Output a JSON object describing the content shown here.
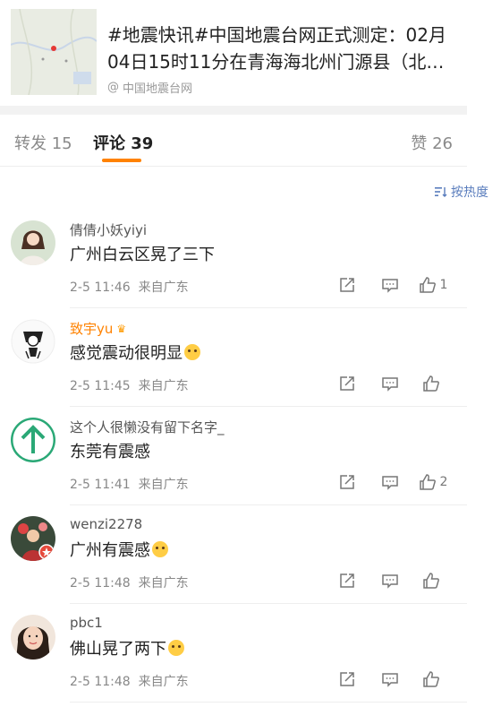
{
  "card": {
    "title": "#地震快讯#中国地震台网正式测定：02月04日15时11分在青海海北州门源县（北…",
    "source": "中国地震台网"
  },
  "tabs": {
    "repost": "转发 15",
    "comment": "评论 39",
    "like": "赞 26"
  },
  "sort": {
    "label": "按热度"
  },
  "comments": [
    {
      "nick": "倩倩小妖yiyi",
      "text": "广州白云区晃了三下",
      "time": "2-5 11:46",
      "from": "来自广东",
      "likes": "1",
      "emoji": ""
    },
    {
      "nick": "致宇yu",
      "text": "感觉震动很明显",
      "time": "2-5 11:45",
      "from": "来自广东",
      "likes": "",
      "emoji": "cry"
    },
    {
      "nick": "这个人很懒没有留下名字_",
      "text": "东莞有震感",
      "time": "2-5 11:41",
      "from": "来自广东",
      "likes": "2",
      "emoji": ""
    },
    {
      "nick": "wenzi2278",
      "text": "广州有震感",
      "time": "2-5 11:48",
      "from": "来自广东",
      "likes": "",
      "emoji": "sweat"
    },
    {
      "nick": "pbc1",
      "text": "佛山晃了两下",
      "time": "2-5 11:48",
      "from": "来自广东",
      "likes": "",
      "emoji": "laugh"
    }
  ],
  "colors": {
    "accent": "#ff8200",
    "link": "#5a7dbd",
    "vip": "#ff8200"
  },
  "icons": [
    "map-thumbnail",
    "at-icon",
    "sort-icon",
    "share-icon",
    "reply-icon",
    "like-icon"
  ]
}
